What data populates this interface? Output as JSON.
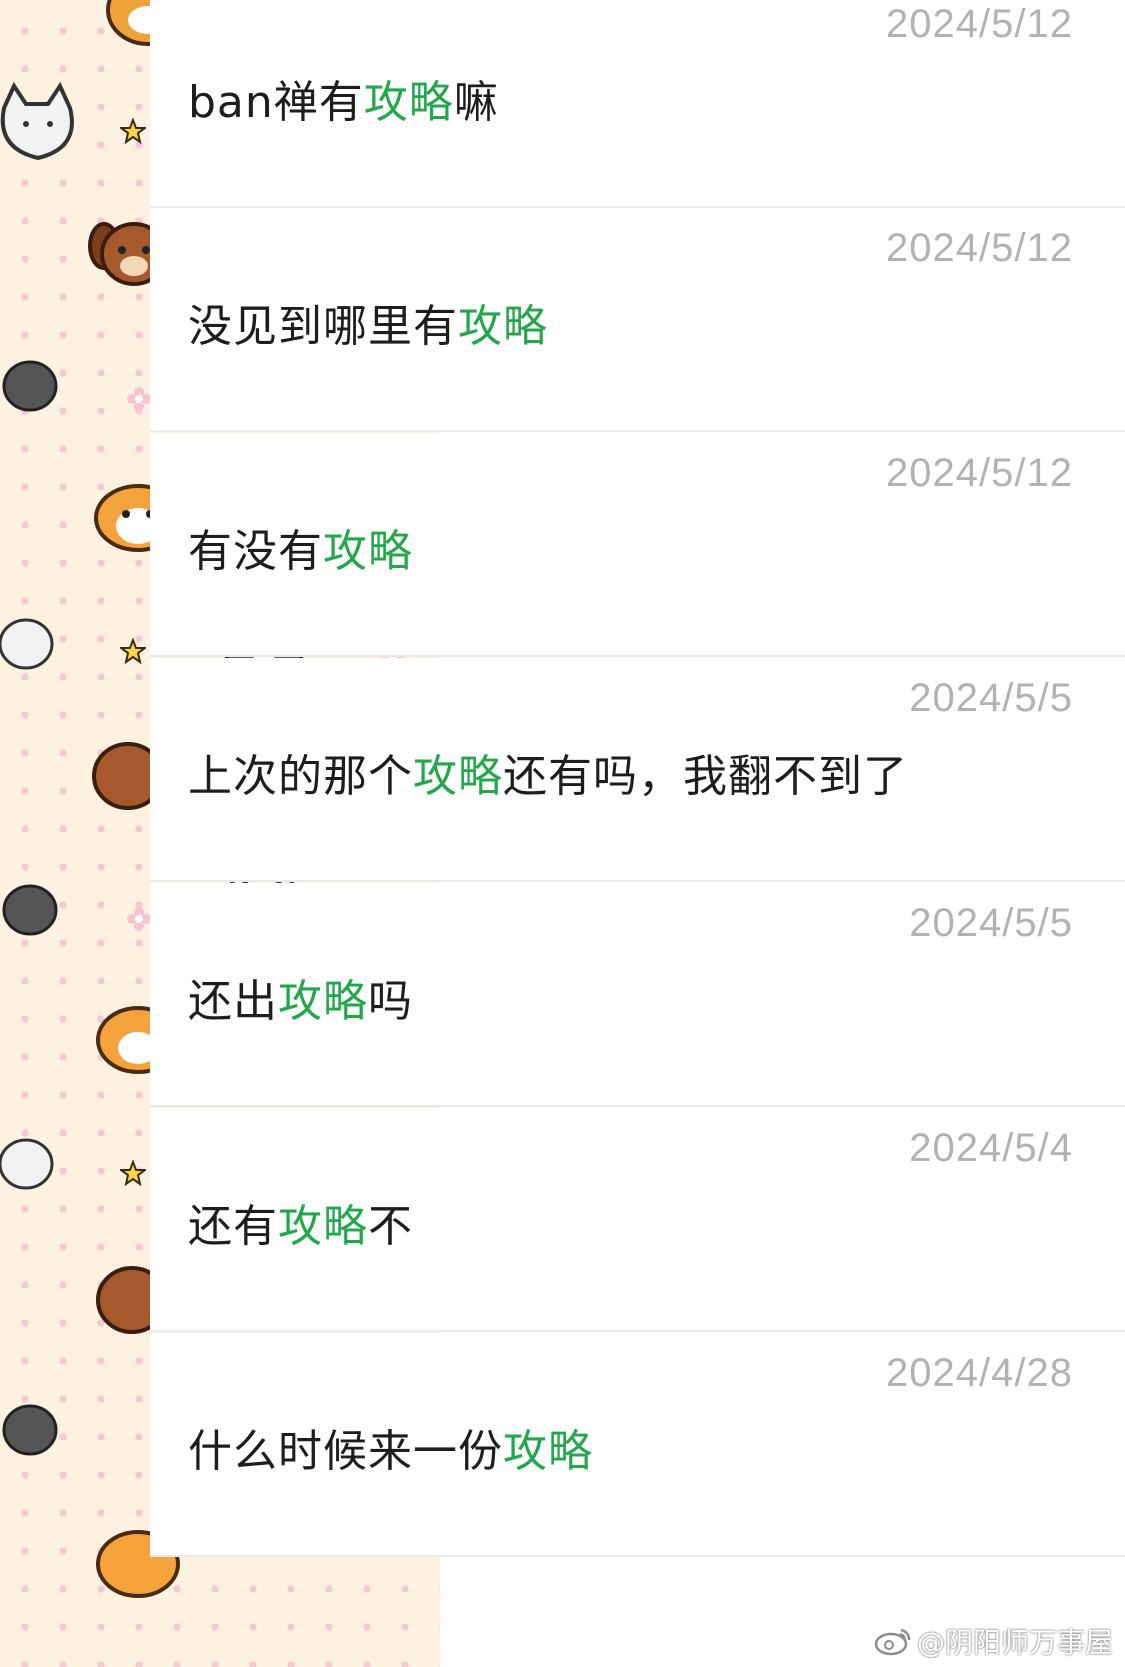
{
  "keyword_color": "#22a74a",
  "date_color": "#b2b2b2",
  "messages": [
    {
      "date": "2024/5/12",
      "before": "ban禅有",
      "keyword": "攻略",
      "after": "嘛"
    },
    {
      "date": "2024/5/12",
      "before": "没见到哪里有",
      "keyword": "攻略",
      "after": ""
    },
    {
      "date": "2024/5/12",
      "before": "有没有",
      "keyword": "攻略",
      "after": ""
    },
    {
      "date": "2024/5/5",
      "before": "上次的那个",
      "keyword": "攻略",
      "after": "还有吗，我翻不到了"
    },
    {
      "date": "2024/5/5",
      "before": "还出",
      "keyword": "攻略",
      "after": "吗"
    },
    {
      "date": "2024/5/4",
      "before": "还有",
      "keyword": "攻略",
      "after": "不"
    },
    {
      "date": "2024/4/28",
      "before": "什么时候来一份",
      "keyword": "攻略",
      "after": ""
    }
  ],
  "watermark": {
    "icon": "weibo-icon",
    "text": "@阴阳师万事屋"
  }
}
